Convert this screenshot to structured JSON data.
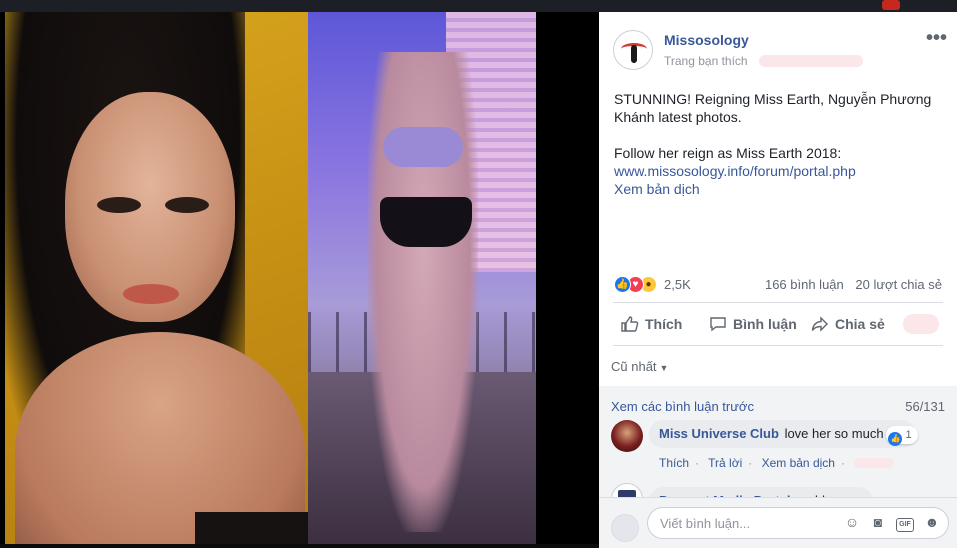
{
  "post": {
    "page_name": "Missosology",
    "subtitle": "Trang bạn thích",
    "more_label": "•••",
    "text_line1": "STUNNING! Reigning Miss Earth, Nguyễn Phương Khánh latest photos.",
    "text_line2": "Follow her reign as Miss Earth 2018:",
    "link": "www.missosology.info/forum/portal.php",
    "translate": "Xem bản dịch"
  },
  "reactions": {
    "count": "2,5K",
    "comments": "166 bình luận",
    "shares": "20 lượt chia sẻ"
  },
  "actions": {
    "like": "Thích",
    "comment": "Bình luận",
    "share": "Chia sẻ"
  },
  "comments": {
    "sort_label": "Cũ nhất",
    "previous_label": "Xem các bình luận trước",
    "counter": "56/131",
    "items": [
      {
        "author": "Miss Universe Club",
        "text": "love her so much",
        "reactions": "1",
        "actions": [
          "Thích",
          "Trả lời",
          "Xem bản dịch"
        ]
      },
      {
        "author": "Pageant Media Portal",
        "text": "goddess"
      }
    ],
    "input_placeholder": "Viết bình luận..."
  },
  "icons": {
    "like": "thumbs-up-icon",
    "comment": "speech-bubble-icon",
    "share": "share-arrow-icon",
    "emoji": "emoji-icon",
    "camera": "camera-icon",
    "gif": "gif-icon",
    "sticker": "sticker-icon"
  },
  "colors": {
    "link_blue": "#385898",
    "like_blue": "#1877f2",
    "love_red": "#f33e58",
    "wow_yellow": "#fcc73b"
  }
}
